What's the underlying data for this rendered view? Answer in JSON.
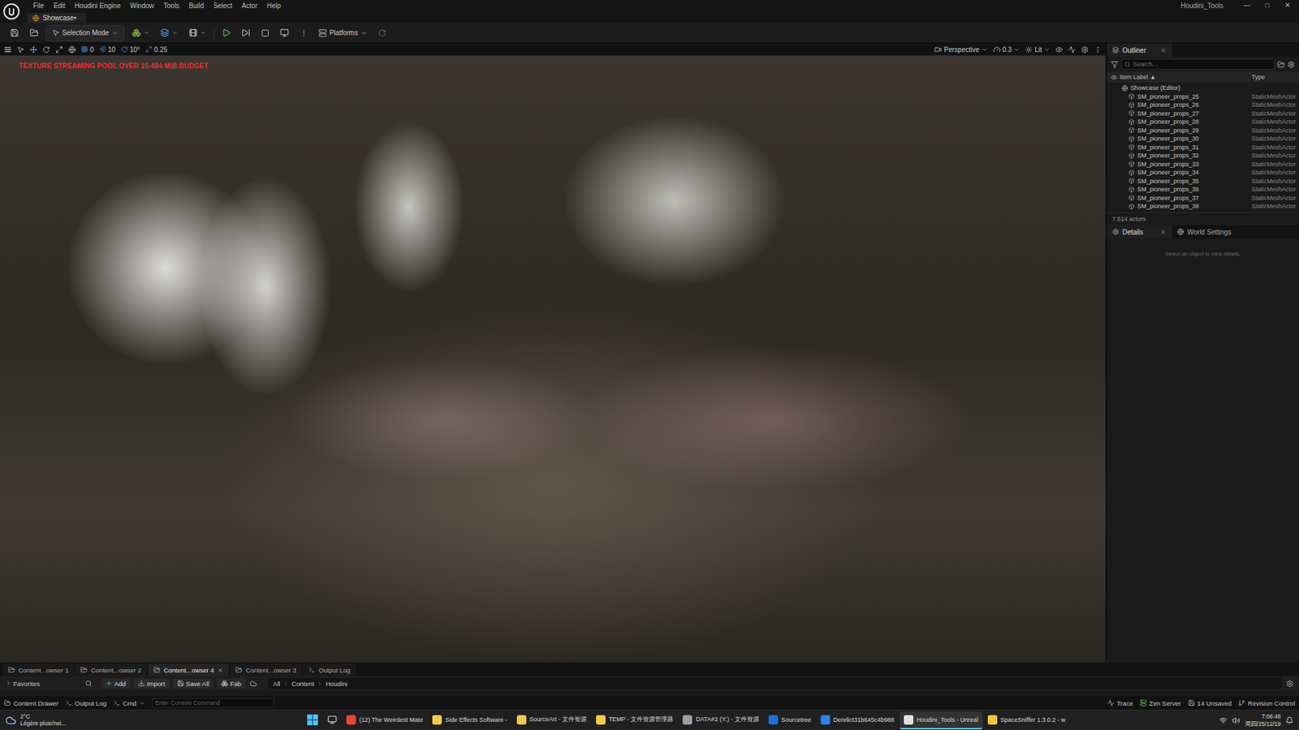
{
  "app": {
    "title": "Houdini_Tools",
    "window_controls": [
      "—",
      "□",
      "✕"
    ]
  },
  "menu": [
    "File",
    "Edit",
    "Houdini Engine",
    "Window",
    "Tools",
    "Build",
    "Select",
    "Actor",
    "Help"
  ],
  "document_tab": {
    "label": "Showcase•"
  },
  "toolbar": {
    "mode": "Selection Mode",
    "platforms": "Platforms"
  },
  "viewport_toolbar": {
    "snap_values": [
      "0",
      "10",
      "10°",
      "0.25"
    ],
    "view": "Perspective",
    "speed": "0.3",
    "lighting": "Lit"
  },
  "viewport": {
    "warning": "TEXTURE STREAMING POOL OVER 15.484 MiB BUDGET"
  },
  "outliner": {
    "title": "Outliner",
    "search_placeholder": "Search...",
    "columns": [
      "Item Label ▲",
      "Type"
    ],
    "rows": [
      {
        "label": "Showcase (Editor)",
        "type": "",
        "kind": "world",
        "selected": false
      },
      {
        "label": "SM_pioneer_props_25",
        "type": "StaticMeshActor",
        "kind": "actor",
        "selected": false
      },
      {
        "label": "SM_pioneer_props_26",
        "type": "StaticMeshActor",
        "kind": "actor",
        "selected": false
      },
      {
        "label": "SM_pioneer_props_27",
        "type": "StaticMeshActor",
        "kind": "actor",
        "selected": false
      },
      {
        "label": "SM_pioneer_props_28",
        "type": "StaticMeshActor",
        "kind": "actor",
        "selected": false
      },
      {
        "label": "SM_pioneer_props_29",
        "type": "StaticMeshActor",
        "kind": "actor",
        "selected": false
      },
      {
        "label": "SM_pioneer_props_30",
        "type": "StaticMeshActor",
        "kind": "actor",
        "selected": false
      },
      {
        "label": "SM_pioneer_props_31",
        "type": "StaticMeshActor",
        "kind": "actor",
        "selected": false
      },
      {
        "label": "SM_pioneer_props_32",
        "type": "StaticMeshActor",
        "kind": "actor",
        "selected": false
      },
      {
        "label": "SM_pioneer_props_33",
        "type": "StaticMeshActor",
        "kind": "actor",
        "selected": false
      },
      {
        "label": "SM_pioneer_props_34",
        "type": "StaticMeshActor",
        "kind": "actor",
        "selected": false
      },
      {
        "label": "SM_pioneer_props_35",
        "type": "StaticMeshActor",
        "kind": "actor",
        "selected": false
      },
      {
        "label": "SM_pioneer_props_36",
        "type": "StaticMeshActor",
        "kind": "actor",
        "selected": false
      },
      {
        "label": "SM_pioneer_props_37",
        "type": "StaticMeshActor",
        "kind": "actor",
        "selected": false
      },
      {
        "label": "SM_pioneer_props_38",
        "type": "StaticMeshActor",
        "kind": "actor",
        "selected": false
      }
    ],
    "count": "7,514 actors"
  },
  "details": {
    "tabs": [
      {
        "label": "Details",
        "selected": true
      },
      {
        "label": "World Settings",
        "selected": false
      }
    ],
    "empty": "Select an object to view details."
  },
  "content_tabs": [
    {
      "label": "Content...owser 1",
      "selected": false
    },
    {
      "label": "Content...owser 2",
      "selected": false
    },
    {
      "label": "Content...owser 4",
      "selected": true
    },
    {
      "label": "Content...owser 3",
      "selected": false
    },
    {
      "label": "Output Log",
      "selected": false
    }
  ],
  "content_toolbar": {
    "favorites": "Favorites",
    "buttons": [
      "Add",
      "Import",
      "Save All",
      "Fab"
    ],
    "breadcrumbs": [
      "All",
      "Content",
      "Houdini"
    ]
  },
  "status_bar": {
    "left": [
      "Content Drawer",
      "Output Log"
    ],
    "cmd": "Cmd",
    "console_placeholder": "Enter Console Command",
    "right": [
      "Trace",
      "Zen Server",
      "14 Unsaved",
      "Revision Control"
    ]
  },
  "taskbar": {
    "weather_temp": "2°C",
    "weather_text": "Légère pluie/nei...",
    "apps": [
      {
        "label": "(12) The Weirdest Mate",
        "color": "#e8453c",
        "selected": false
      },
      {
        "label": "Side Effects Software -",
        "color": "#f2c94c",
        "selected": false
      },
      {
        "label": "SourceArt - 文件资源",
        "color": "#f2c94c",
        "selected": false
      },
      {
        "label": "TEMP - 文件资源管理器",
        "color": "#f2c94c",
        "selected": false
      },
      {
        "label": "DATA#2 (Y:) - 文件资源",
        "color": "#9aa0a6",
        "selected": false
      },
      {
        "label": "Sourcetree",
        "color": "#1e6fd9",
        "selected": false
      },
      {
        "label": "Derelict31b645c4b988",
        "color": "#2f80ed",
        "selected": false
      },
      {
        "label": "Houdini_Tools - Unreal",
        "color": "#e0e0e0",
        "selected": true
      },
      {
        "label": "SpaceSniffer 1.3.0.2 - w",
        "color": "#f5c542",
        "selected": false
      }
    ],
    "time": "7:06:48",
    "date": "周四/25/12/19"
  }
}
